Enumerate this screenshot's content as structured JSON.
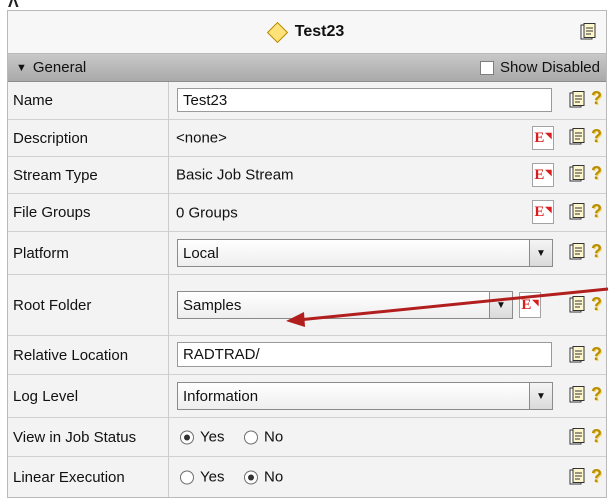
{
  "corner_glyph": "Ʌ",
  "title": "Test23",
  "section": {
    "name": "General",
    "show_disabled_label": "Show Disabled"
  },
  "rows": [
    {
      "label": "Name",
      "value": "Test23"
    },
    {
      "label": "Description",
      "value": "<none>"
    },
    {
      "label": "Stream Type",
      "value": "Basic Job Stream"
    },
    {
      "label": "File Groups",
      "value": "0 Groups"
    },
    {
      "label": "Platform",
      "value": "Local"
    },
    {
      "label": "Root Folder",
      "value": "Samples"
    },
    {
      "label": "Relative Location",
      "value": "RADTRAD/"
    },
    {
      "label": "Log Level",
      "value": "Information"
    },
    {
      "label": "View in Job Status",
      "options": [
        "Yes",
        "No"
      ],
      "selected": "Yes"
    },
    {
      "label": "Linear Execution",
      "options": [
        "Yes",
        "No"
      ],
      "selected": "No"
    }
  ],
  "button_glyph": "E",
  "help_glyph": "?",
  "dropdown_glyph": "▼",
  "colors": {
    "annotation_arrow": "#b21e1e",
    "edit_button_text": "#d81e1e"
  }
}
